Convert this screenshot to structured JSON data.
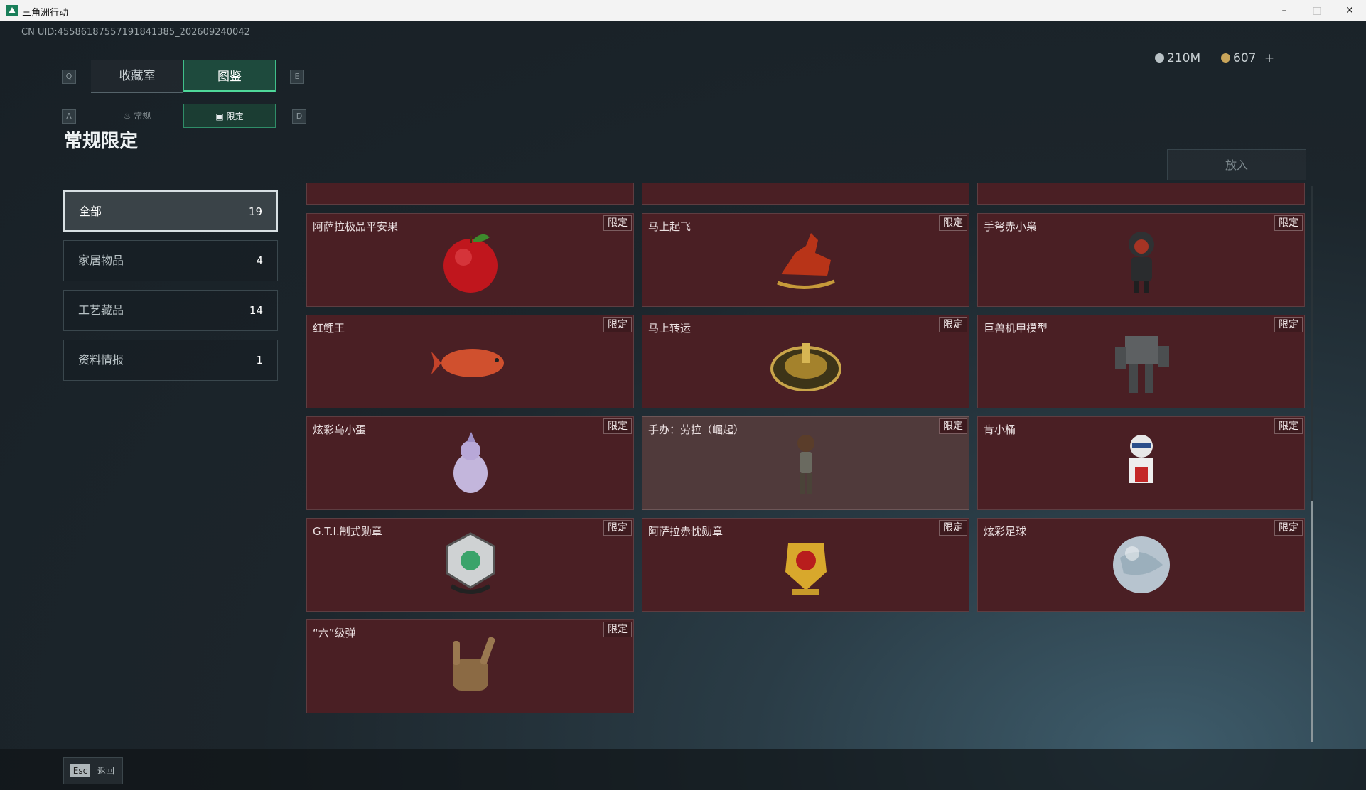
{
  "window": {
    "title": "三角洲行动",
    "minimize": "–",
    "maximize": "□",
    "close": "✕"
  },
  "uid": "CN UID:4558618755719184138​5_202609240042",
  "tabs": {
    "left_key": "Q",
    "right_key": "E",
    "items": [
      "收藏室",
      "图鉴"
    ],
    "active": "图鉴"
  },
  "subtabs": {
    "left_key": "A",
    "right_key": "D",
    "items": [
      "常规",
      "限定"
    ],
    "active": "限定"
  },
  "currency": {
    "silver": "210M",
    "gold": "607",
    "add": "+"
  },
  "page_title": "常规限定",
  "place_button": "放入",
  "categories": [
    {
      "name": "全部",
      "count": "19"
    },
    {
      "name": "家居物品",
      "count": "4"
    },
    {
      "name": "工艺藏品",
      "count": "14"
    },
    {
      "name": "资料情报",
      "count": "1"
    }
  ],
  "tag_label": "限定",
  "items": [
    {
      "name": "阿萨拉极品平安果",
      "icon": "red-apple"
    },
    {
      "name": "马上起飞",
      "icon": "red-horse"
    },
    {
      "name": "手弩赤小枭",
      "icon": "hooded-figure"
    },
    {
      "name": "红鲤王",
      "icon": "red-carp"
    },
    {
      "name": "马上转运",
      "icon": "gold-wheel"
    },
    {
      "name": "巨兽机甲模型",
      "icon": "mecha-model"
    },
    {
      "name": "炫彩乌小蛋",
      "icon": "egg-creature"
    },
    {
      "name": "手办：劳拉（崛起）",
      "icon": "lara-figure"
    },
    {
      "name": "肯小桶",
      "icon": "bucket-figure"
    },
    {
      "name": "G.T.I.制式勋章",
      "icon": "gti-medal"
    },
    {
      "name": "阿萨拉赤忱勋章",
      "icon": "gold-medal"
    },
    {
      "name": "炫彩足球",
      "icon": "iridescent-ball"
    },
    {
      "name": "“六”级弹",
      "icon": "bronze-hand"
    }
  ],
  "esc": {
    "key": "Esc",
    "label": "返回"
  },
  "colors": {
    "accent": "#4fd89a",
    "card": "#4a1f24"
  }
}
